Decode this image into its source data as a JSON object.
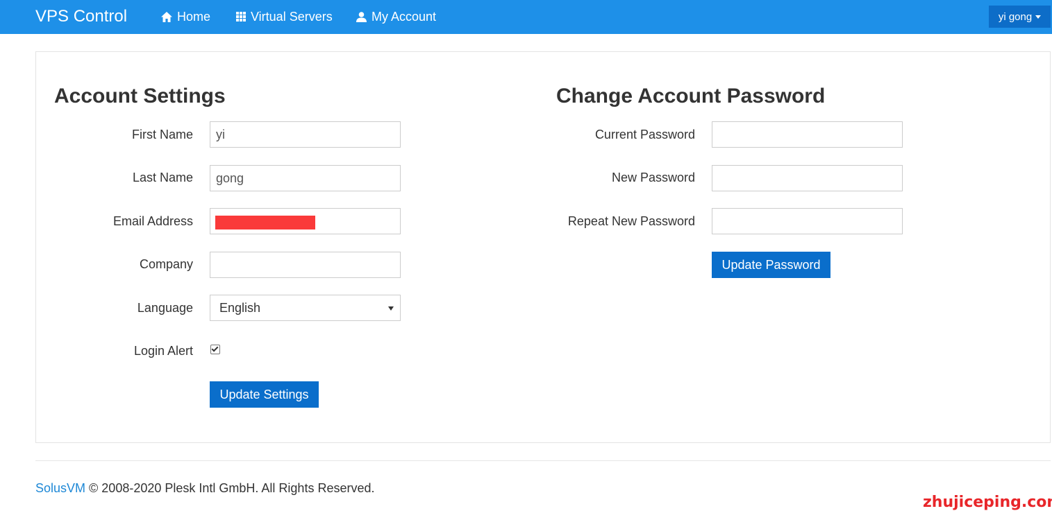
{
  "navbar": {
    "brand": "VPS Control",
    "items": [
      {
        "label": "Home",
        "icon": "home-icon"
      },
      {
        "label": "Virtual Servers",
        "icon": "grid-icon"
      },
      {
        "label": "My Account",
        "icon": "user-icon"
      }
    ],
    "user": "yi gong",
    "bg_color": "#1e90e8"
  },
  "account_settings": {
    "title": "Account Settings",
    "fields": [
      {
        "label": "First Name",
        "value": "yi"
      },
      {
        "label": "Last Name",
        "value": "gong"
      },
      {
        "label": "Email Address",
        "value": ""
      },
      {
        "label": "Company",
        "value": ""
      }
    ],
    "language_label": "Language",
    "language_value": "English",
    "login_alert_label": "Login Alert",
    "login_alert_checked": true,
    "submit_label": "Update Settings"
  },
  "change_password": {
    "title": "Change Account Password",
    "fields": [
      {
        "label": "Current Password",
        "value": ""
      },
      {
        "label": "New Password",
        "value": ""
      },
      {
        "label": "Repeat New Password",
        "value": ""
      }
    ],
    "submit_label": "Update Password"
  },
  "footer": {
    "link": "SolusVM",
    "text": " © 2008-2020 Plesk Intl GmbH. All Rights Reserved."
  },
  "watermark": "zhujiceping.com",
  "colors": {
    "accent": "#0a6ecb",
    "redaction": "#fa3a3a",
    "watermark": "#e8262a"
  }
}
